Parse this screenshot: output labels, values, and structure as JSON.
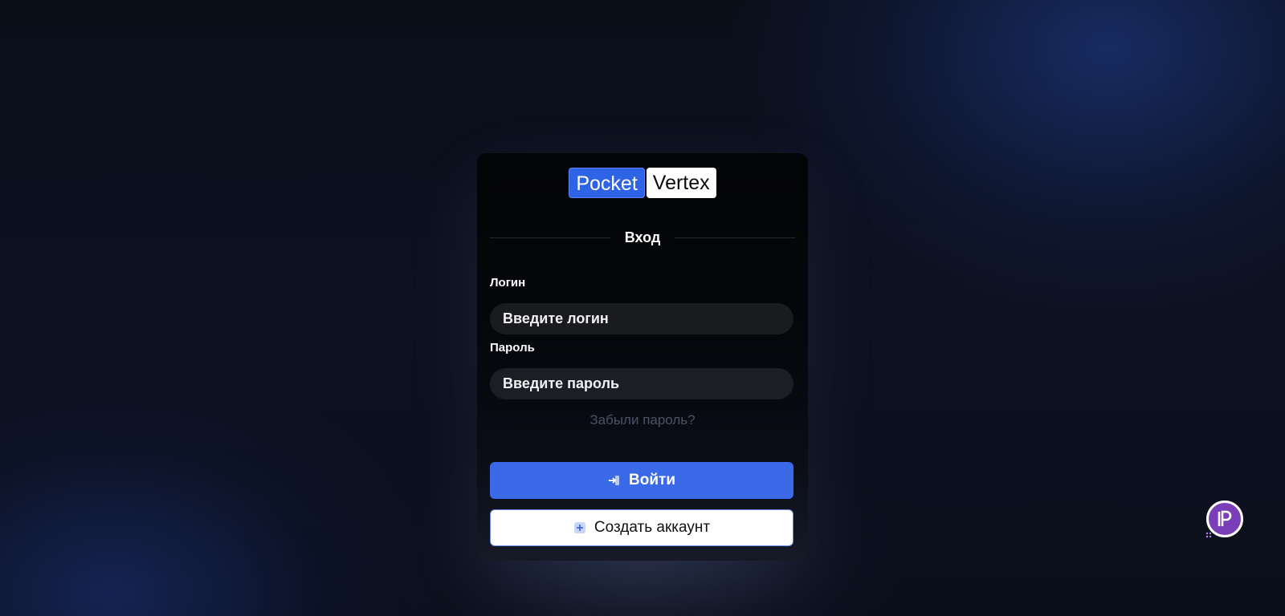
{
  "logo": {
    "part1": "Pocket",
    "part2": "Vertex"
  },
  "form": {
    "heading": "Вход",
    "login_label": "Логин",
    "login_value": "",
    "login_placeholder": "Введите логин",
    "password_label": "Пароль",
    "password_value": "",
    "password_placeholder": "Введите пароль",
    "forgot_link": "Забыли пароль?",
    "login_button": "Войти",
    "register_button": "Создать аккаунт"
  },
  "icons": {
    "login_button_icon": "sign-in-icon",
    "register_button_icon": "plus-square-icon",
    "floating_badge_icon": "p-logo-icon"
  },
  "colors": {
    "accent": "#3a6ae8",
    "logo_accent": "#2f63e6",
    "badge": "#7a3fb8"
  }
}
